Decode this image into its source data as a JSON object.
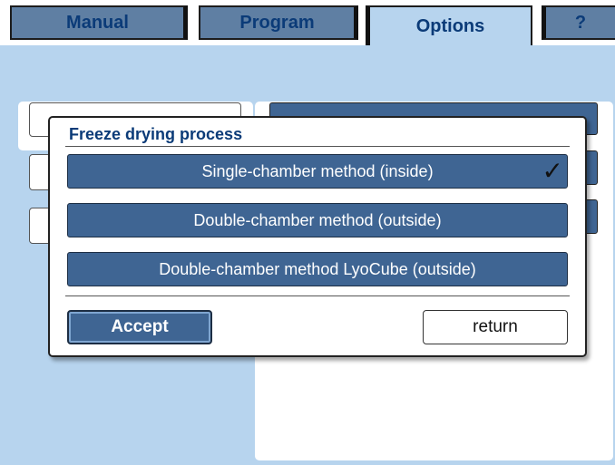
{
  "tabs": [
    {
      "label": "Manual"
    },
    {
      "label": "Program"
    },
    {
      "label": "Options"
    },
    {
      "label": "?"
    }
  ],
  "dialog": {
    "title": "Freeze drying process",
    "options": [
      {
        "label": "Single-chamber method (inside)",
        "selected": true
      },
      {
        "label": "Double-chamber method (outside)",
        "selected": false
      },
      {
        "label": "Double-chamber method LyoCube (outside)",
        "selected": false
      }
    ],
    "accept_label": "Accept",
    "return_label": "return",
    "checkmark": "✓"
  },
  "colors": {
    "background": "#b7d4ee",
    "tab_inactive": "#5f7fa3",
    "button_blue": "#3f6593",
    "title_text": "#0b3b78"
  }
}
